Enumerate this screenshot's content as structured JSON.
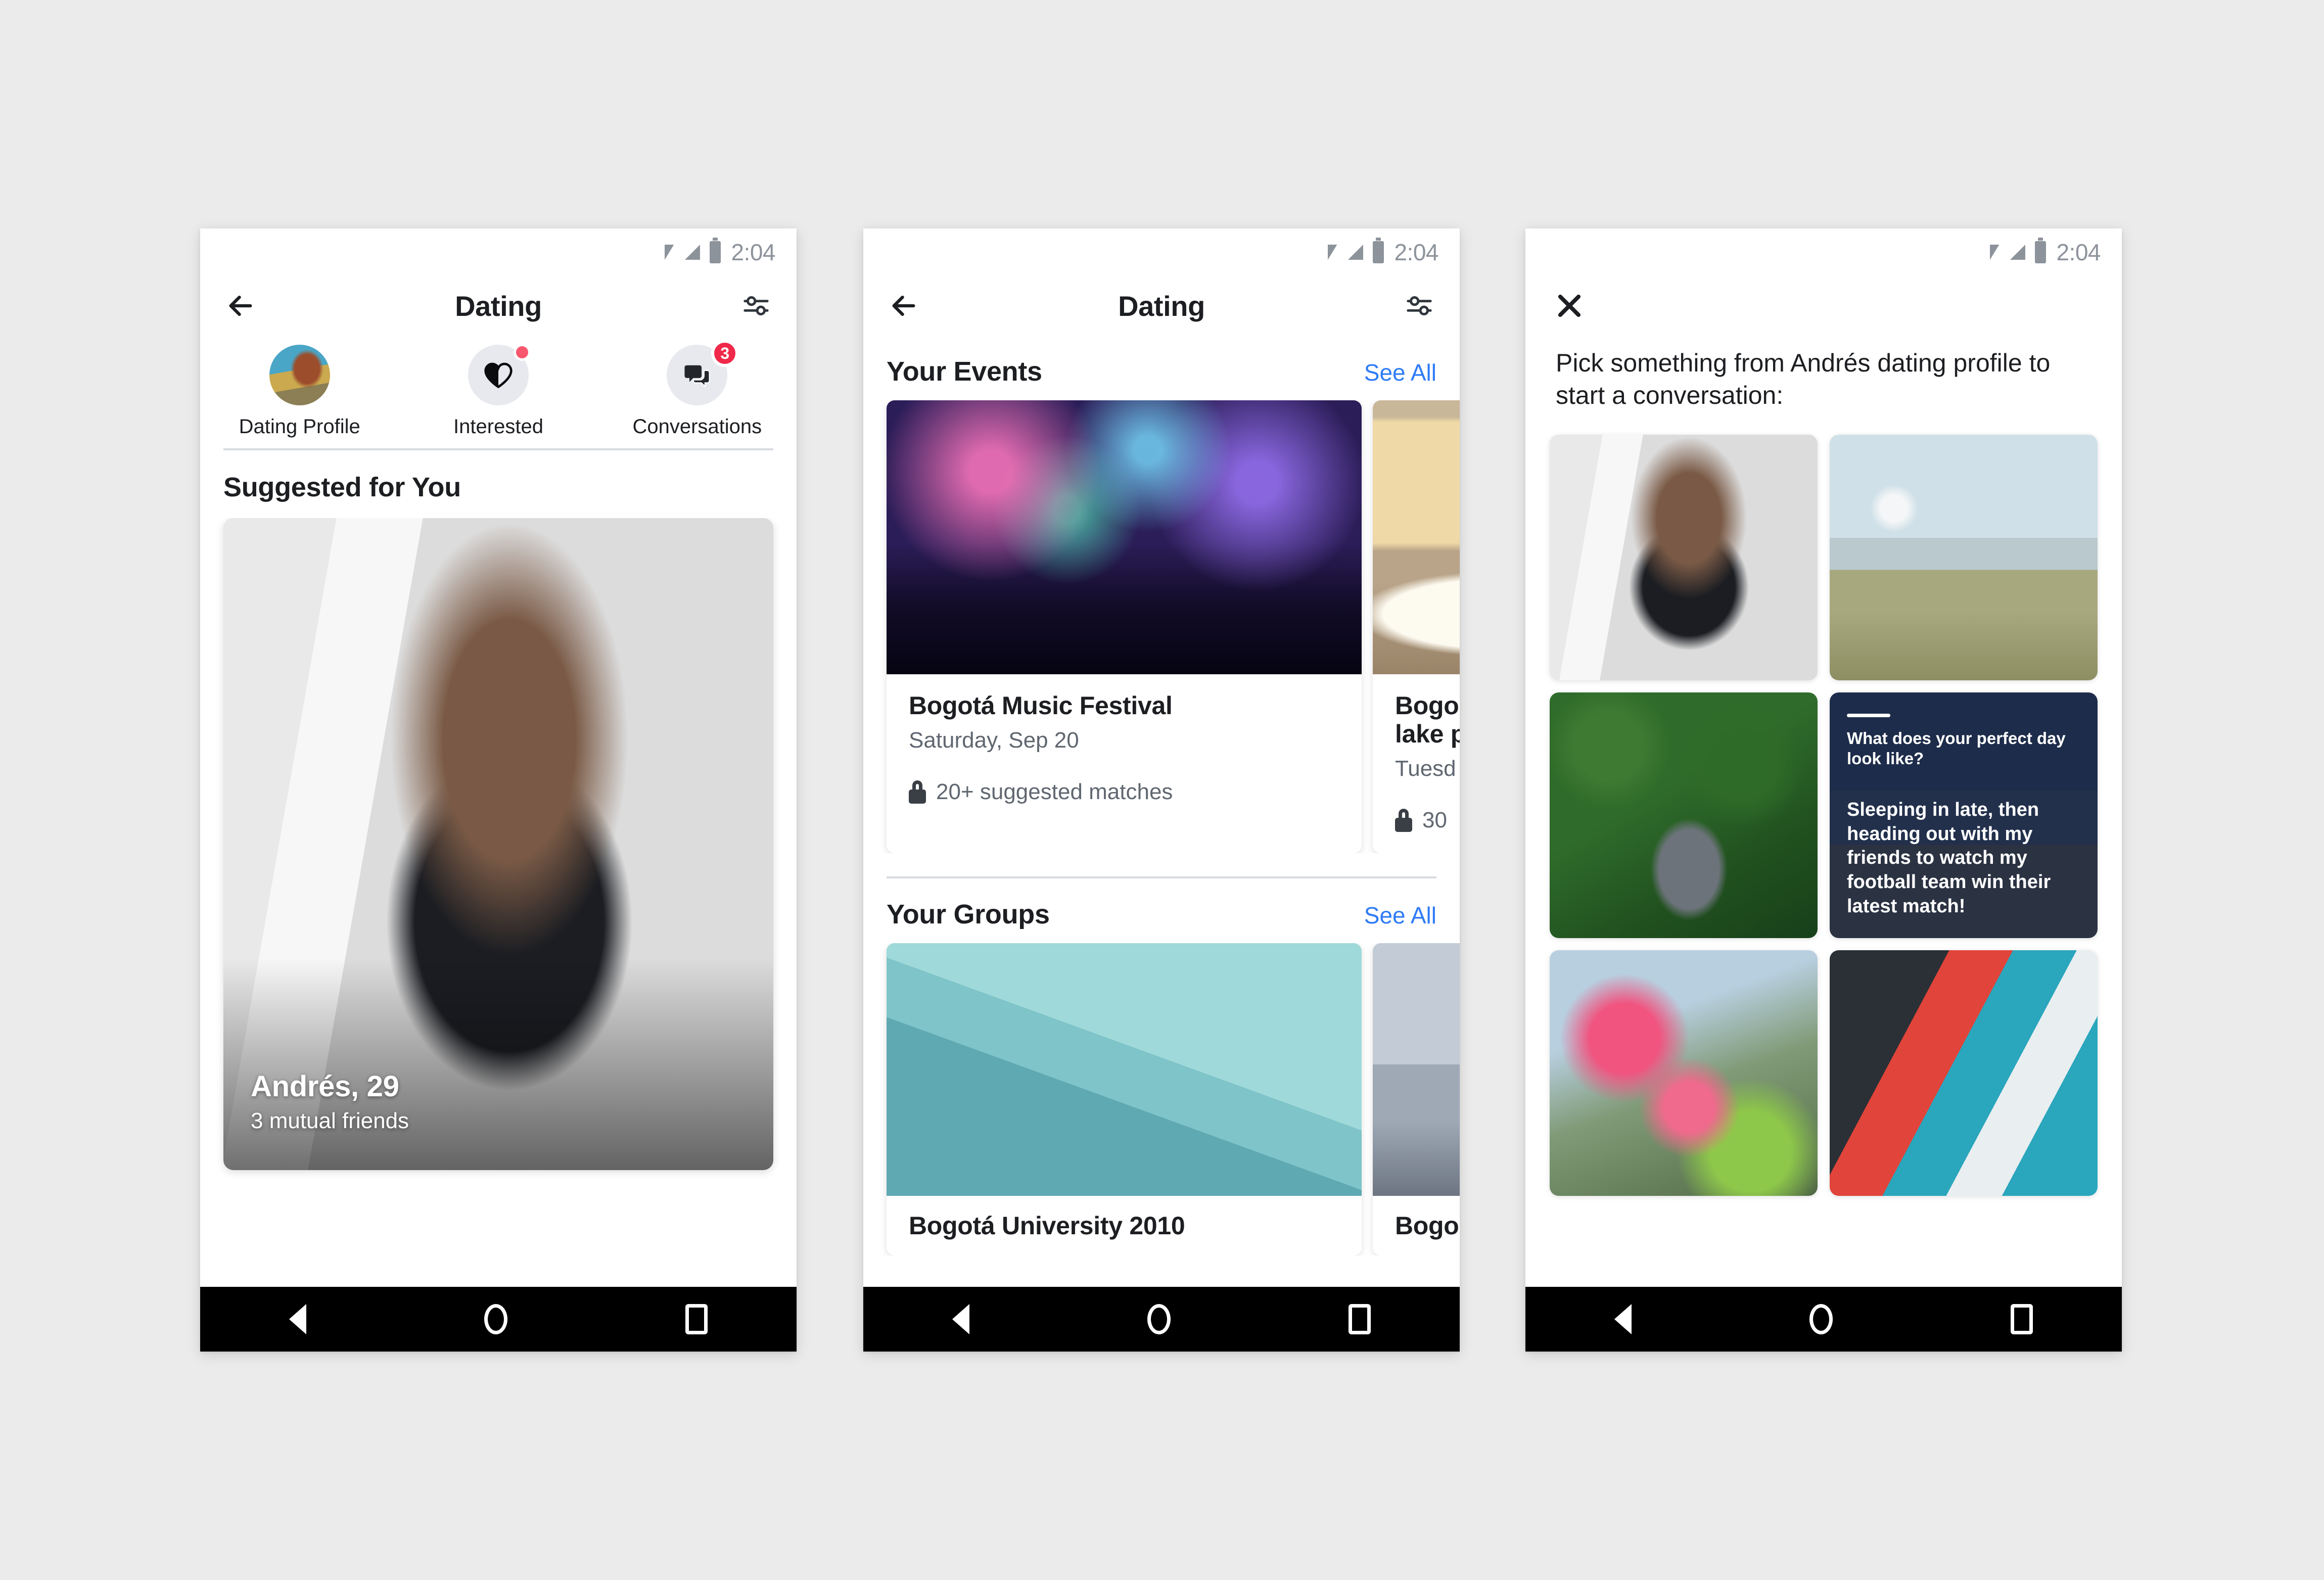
{
  "background_color": "#ebebeb",
  "status_bar": {
    "time": "2:04",
    "wifi_icon": "wifi-icon",
    "signal_icon": "signal-icon",
    "battery_icon": "battery-icon"
  },
  "accent_colors": {
    "link_blue": "#2e7bf6",
    "badge_red": "#f02849",
    "dot_pink": "#f9576e",
    "dark_navy": "#1b2740"
  },
  "phone_1": {
    "nav": {
      "back_icon": "arrow-left-icon",
      "title": "Dating",
      "filter_icon": "sliders-icon"
    },
    "tabs": [
      {
        "label": "Dating Profile",
        "icon": "profile-avatar",
        "badge": null
      },
      {
        "label": "Interested",
        "icon": "heart-icon",
        "badge": "dot"
      },
      {
        "label": "Conversations",
        "icon": "chat-bubbles-icon",
        "badge": "3"
      }
    ],
    "section_title": "Suggested for You",
    "suggested_card": {
      "photo": "man-sitting-on-stool",
      "name": "Andrés, 29",
      "mutual": "3 mutual friends"
    }
  },
  "phone_2": {
    "nav": {
      "back_icon": "arrow-left-icon",
      "title": "Dating",
      "filter_icon": "sliders-icon"
    },
    "events_section": {
      "heading": "Your Events",
      "see_all": "See All",
      "cards": [
        {
          "photo": "concert-crowd-lights",
          "title": "Bogotá Music Festival",
          "date": "Saturday, Sep 20",
          "lock_icon": "lock-icon",
          "matches": "20+ suggested matches"
        },
        {
          "photo": "fries-and-egg-plate",
          "title": "Bogo",
          "title_line2": "lake p",
          "date": "Tuesd",
          "lock_icon": "lock-icon",
          "matches": "30"
        }
      ]
    },
    "groups_section": {
      "heading": "Your Groups",
      "see_all": "See All",
      "cards": [
        {
          "photo": "glass-building",
          "title": "Bogotá University 2010"
        },
        {
          "photo": "cloudy-sky",
          "title": "Bogo"
        }
      ]
    }
  },
  "phone_3": {
    "nav": {
      "close_icon": "close-x-icon"
    },
    "prompt": "Pick something from Andrés dating profile to start a conversation:",
    "tiles": [
      {
        "kind": "photo",
        "photo": "man-sitting-on-stool",
        "name": "tile-photo-stool"
      },
      {
        "kind": "photo",
        "photo": "man-with-drone-on-hill",
        "name": "tile-photo-drone"
      },
      {
        "kind": "photo",
        "photo": "man-in-front-of-green-wall",
        "name": "tile-photo-greenwall"
      },
      {
        "kind": "quote",
        "photo": "bogota-street-at-dusk",
        "question": "What does your perfect day look like?",
        "answer": "Sleeping in late, then heading out with my friends to watch my football team win their latest match!",
        "name": "tile-prompt-answer"
      },
      {
        "kind": "photo",
        "photo": "pink-flowers-and-hat",
        "name": "tile-photo-flowers"
      },
      {
        "kind": "photo",
        "photo": "man-against-mural-wall",
        "name": "tile-photo-mural"
      }
    ]
  },
  "android_nav": {
    "back": "android-back-icon",
    "home": "android-home-icon",
    "recents": "android-recents-icon"
  }
}
